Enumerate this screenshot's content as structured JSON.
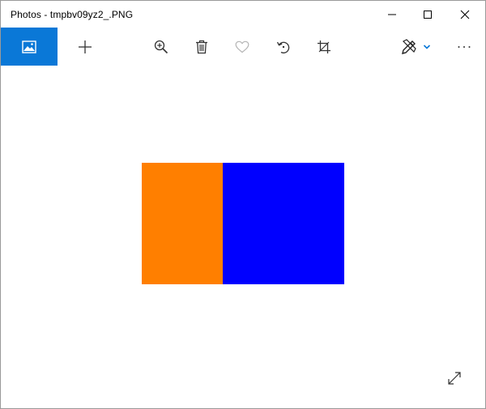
{
  "window": {
    "title": "Photos - tmpbv09yz2_.PNG"
  },
  "titlebar": {
    "minimize_icon": "minimize-icon",
    "maximize_icon": "maximize-icon",
    "close_icon": "close-icon"
  },
  "toolbar": {
    "accent_color": "#0a78d7",
    "items": [
      {
        "icon": "gallery-icon"
      },
      {
        "icon": "add-icon"
      },
      {
        "icon": "zoom-in-icon"
      },
      {
        "icon": "delete-icon"
      },
      {
        "icon": "heart-icon"
      },
      {
        "icon": "rotate-icon"
      },
      {
        "icon": "crop-icon"
      },
      {
        "icon": "edit-create-icon"
      },
      {
        "icon": "more-icon"
      }
    ]
  },
  "image": {
    "colors": [
      "#ff7f00",
      "#0000ff"
    ]
  },
  "canvas": {
    "fullscreen_icon": "fullscreen-icon"
  }
}
